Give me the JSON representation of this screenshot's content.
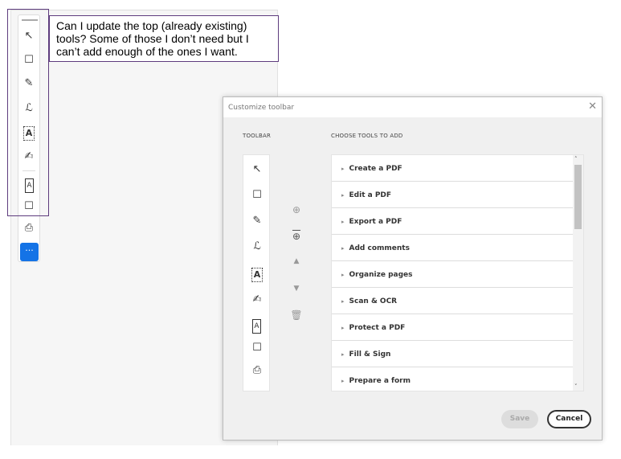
{
  "callout": {
    "text": "Can I update the top (already existing) tools? Some of those I don’t need but I can’t add enough of the ones I want."
  },
  "sidebar": {
    "icons": [
      "↖",
      "☐",
      "✎",
      "ℒ",
      "A",
      "✍",
      "A",
      "☐",
      "⎙"
    ],
    "more_label": "···"
  },
  "dialog": {
    "title": "Customize toolbar",
    "close_glyph": "✕",
    "toolbar_label": "TOOLBAR",
    "choose_label": "CHOOSE TOOLS TO ADD",
    "tools": [
      "Create a PDF",
      "Edit a PDF",
      "Export a PDF",
      "Add comments",
      "Organize pages",
      "Scan & OCR",
      "Protect a PDF",
      "Fill & Sign",
      "Prepare a form"
    ],
    "save_label": "Save",
    "cancel_label": "Cancel"
  },
  "colors": {
    "accent": "#1473e6",
    "annotation": "#5e3c7e"
  }
}
